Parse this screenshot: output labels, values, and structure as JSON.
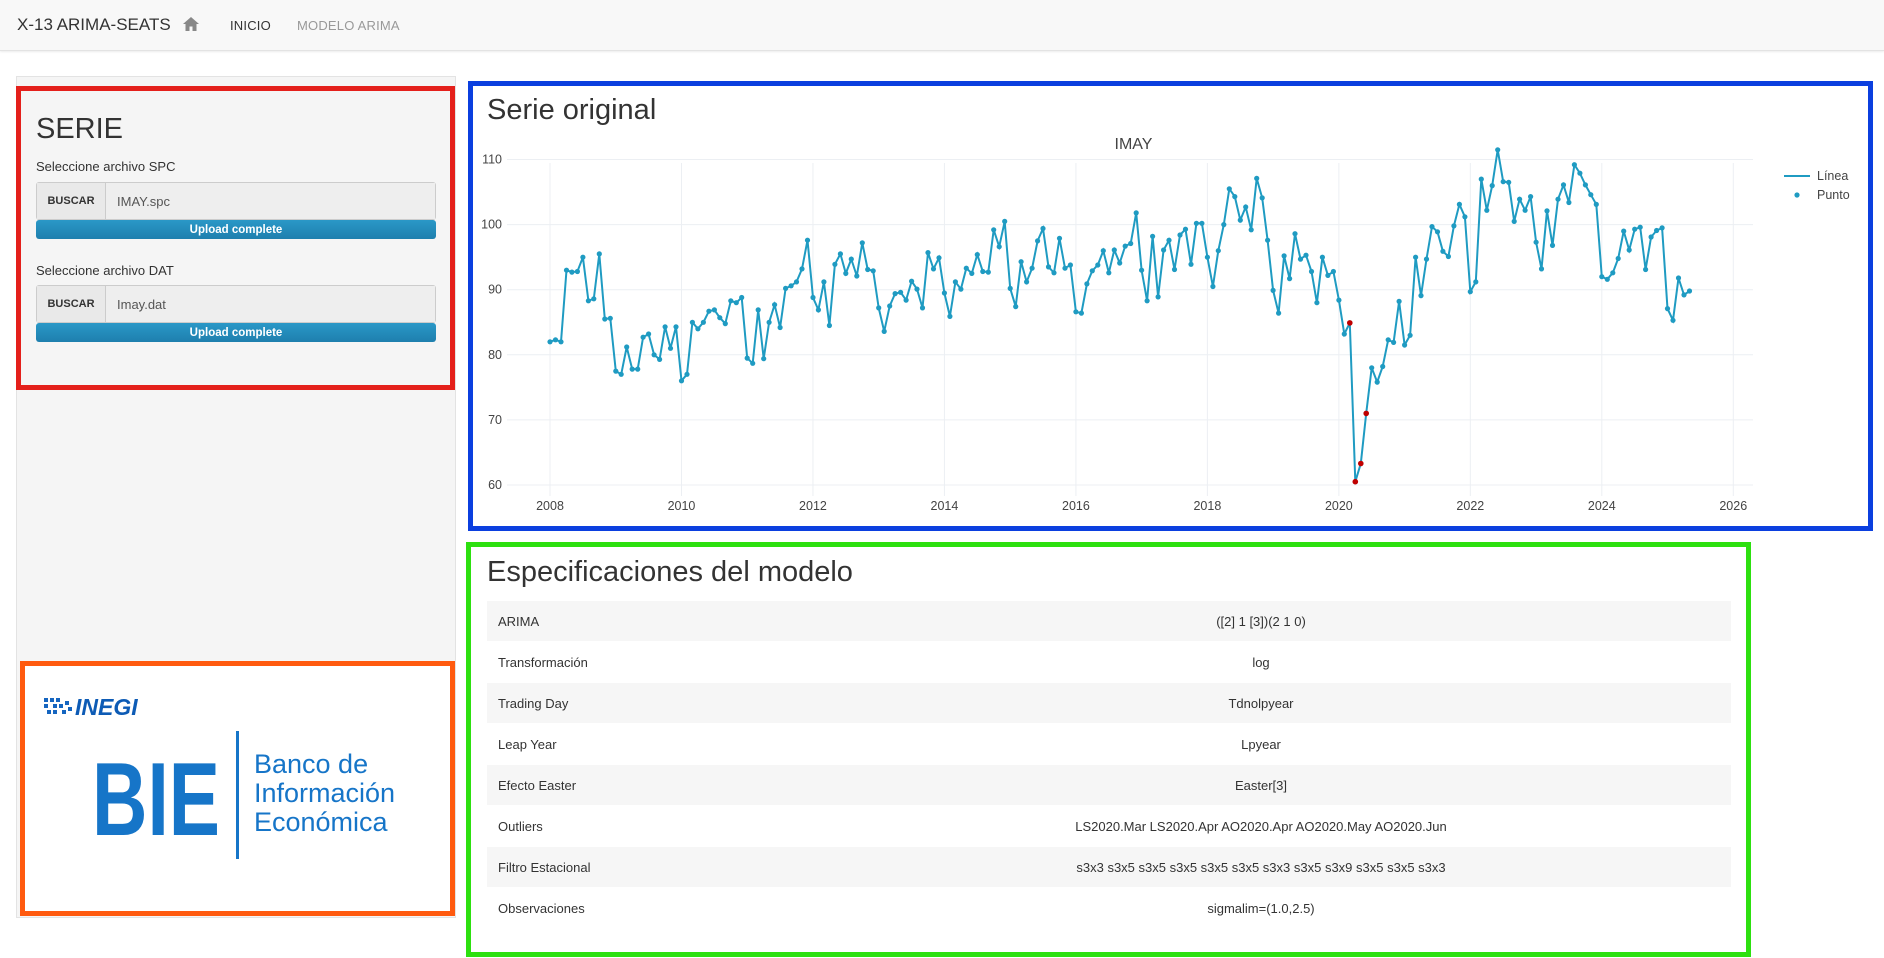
{
  "navbar": {
    "brand": "X-13 ARIMA-SEATS",
    "home_icon": "home-icon",
    "links": [
      "INICIO",
      "MODELO ARIMA"
    ]
  },
  "sidebar": {
    "title": "SERIE",
    "spc": {
      "label": "Seleccione archivo SPC",
      "button": "BUSCAR",
      "value": "IMAY.spc",
      "progress_text": "Upload complete",
      "progress": 1.0
    },
    "dat": {
      "label": "Seleccione archivo DAT",
      "button": "BUSCAR",
      "value": "Imay.dat",
      "progress_text": "Upload complete",
      "progress": 1.0
    },
    "logo": {
      "org": "INEGI",
      "acronym": "BIE",
      "line1": "Banco de",
      "line2": "Información",
      "line3": "Económica"
    }
  },
  "chart_panel": {
    "title": "Serie original"
  },
  "chart_data": {
    "type": "line",
    "title": "IMAY",
    "xlabel": "",
    "ylabel": "",
    "xlim": [
      2007.3,
      2026.3
    ],
    "ylim": [
      58,
      113
    ],
    "xticks": [
      2008,
      2010,
      2012,
      2014,
      2016,
      2018,
      2020,
      2022,
      2024,
      2026
    ],
    "yticks": [
      60,
      70,
      80,
      90,
      100,
      110
    ],
    "grid": true,
    "legend_position": "top-right",
    "colors": {
      "line": "#1f9bc2",
      "outlier": "#c00000"
    },
    "series": [
      {
        "name": "Línea",
        "style": "line",
        "start_year": 2008,
        "start_month": 1,
        "values": [
          82,
          82.3,
          82,
          93,
          92.7,
          92.8,
          95,
          88.3,
          88.6,
          95.5,
          85.5,
          85.6,
          77.5,
          77,
          81.2,
          77.8,
          77.8,
          82.7,
          83.2,
          80,
          79.3,
          84.3,
          81,
          84.3,
          76,
          77,
          85,
          84,
          85,
          86.7,
          86.9,
          85.7,
          84.8,
          88.3,
          88,
          88.8,
          79.5,
          78.7,
          86.9,
          79.4,
          85,
          87.7,
          84.2,
          90.2,
          90.6,
          91.2,
          93.2,
          97.6,
          88.8,
          86.9,
          91.2,
          84.5,
          93.9,
          95.5,
          92.5,
          94.7,
          92.1,
          97.2,
          93.1,
          92.9,
          87.2,
          83.6,
          87.5,
          89.4,
          89.6,
          88.4,
          91.3,
          90.1,
          87.2,
          95.7,
          93.2,
          94.9,
          89.5,
          85.9,
          91.2,
          90.1,
          93.3,
          92.5,
          95.4,
          92.8,
          92.7,
          99.2,
          96.6,
          100.5,
          90.2,
          87.4,
          94.3,
          91.2,
          93.3,
          97.5,
          99.4,
          93.5,
          92.6,
          97.9,
          93.3,
          93.8,
          86.6,
          86.4,
          90.9,
          92.9,
          93.8,
          96,
          92.6,
          96.1,
          94.1,
          96.7,
          97.1,
          101.8,
          93,
          88.3,
          98.2,
          88.9,
          96.1,
          97.6,
          93.1,
          98.4,
          99.3,
          93.9,
          100.2,
          100.2,
          95,
          90.5,
          96,
          100,
          105.5,
          104.3,
          100.7,
          102.7,
          99.2,
          107.1,
          104.1,
          97.6,
          89.9,
          86.4,
          95.2,
          91.7,
          98.6,
          94.7,
          95.3,
          92.8,
          88,
          95,
          92.2,
          92.8,
          88.4,
          83.2,
          84.9,
          60.5,
          63.3,
          71,
          78,
          75.8,
          78.2,
          82.3,
          81.9,
          88.2,
          81.5,
          83,
          95,
          89.1,
          94.7,
          99.7,
          98.9,
          95.9,
          95.1,
          99.8,
          103.1,
          101.2,
          89.7,
          91.2,
          107,
          102.2,
          106,
          111.5,
          106.6,
          106.5,
          100.5,
          103.9,
          102.2,
          104.3,
          97.3,
          93.2,
          102.1,
          96.8,
          103.9,
          106.1,
          103.4,
          109.2,
          107.9,
          106.1,
          104.6,
          103.1,
          92,
          91.6,
          92.6,
          94.8,
          99,
          96.1,
          99.3,
          99.6,
          93.1,
          98.1,
          99.1,
          99.5,
          87.1,
          85.3,
          91.8,
          89.2,
          89.8
        ]
      },
      {
        "name": "Punto",
        "style": "markers",
        "note": "marker on every observation"
      }
    ],
    "highlighted_points": [
      {
        "x": "2020-Mar",
        "y": 84.9
      },
      {
        "x": "2020-Apr",
        "y": 60.5
      },
      {
        "x": "2020-May",
        "y": 63.3
      },
      {
        "x": "2020-Jun",
        "y": 71
      }
    ]
  },
  "specs": {
    "title": "Especificaciones del modelo",
    "rows": [
      {
        "label": "ARIMA",
        "value": "([2] 1 [3])(2 1 0)"
      },
      {
        "label": "Transformación",
        "value": "log"
      },
      {
        "label": "Trading Day",
        "value": "Tdnolpyear"
      },
      {
        "label": "Leap Year",
        "value": "Lpyear"
      },
      {
        "label": "Efecto Easter",
        "value": "Easter[3]"
      },
      {
        "label": "Outliers",
        "value": "LS2020.Mar LS2020.Apr AO2020.Apr AO2020.May AO2020.Jun"
      },
      {
        "label": "Filtro Estacional",
        "value": "s3x3 s3x5 s3x5 s3x5 s3x5 s3x5 s3x3 s3x5 s3x9 s3x5 s3x5 s3x3"
      },
      {
        "label": "Observaciones",
        "value": "sigmalim=(1.0,2.5)"
      }
    ]
  },
  "highlight_colors": {
    "red": "#e4201b",
    "orange": "#ff5a0f",
    "blue": "#0b3fdf",
    "green": "#2de00f"
  }
}
